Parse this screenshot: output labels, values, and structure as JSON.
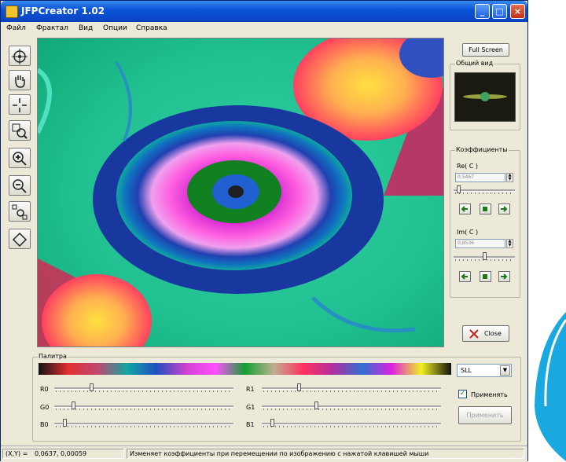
{
  "window": {
    "title": "JFPCreator 1.02"
  },
  "menu": {
    "items": [
      "Файл",
      "Фрактал",
      "Вид",
      "Опции",
      "Справка"
    ]
  },
  "toolbar": {
    "icons": [
      "target-icon",
      "hand-icon",
      "crosshair-icon",
      "zoom-window-icon",
      "zoom-in-icon",
      "zoom-out-icon",
      "fit-icon",
      "diamond-icon"
    ]
  },
  "right_panel": {
    "fullscreen_label": "Full Screen",
    "overview_label": "Общий вид",
    "coeff_label": "Коэффициенты",
    "re_label": "Re( C )",
    "re_value": "0,5467",
    "im_label": "Im( C )",
    "im_value": "0,8536",
    "close_label": "Close",
    "re_slider_value": 0.05,
    "im_slider_value": 0.5
  },
  "palette": {
    "label": "Палитра",
    "select_value": "SLL",
    "apply_checkbox_label": "Применять",
    "apply_checked": true,
    "apply_button_label": "Применить",
    "sliders": [
      {
        "label": "R0",
        "value": 0.2
      },
      {
        "label": "G0",
        "value": 0.1
      },
      {
        "label": "B0",
        "value": 0.05
      },
      {
        "label": "R1",
        "value": 0.2
      },
      {
        "label": "G1",
        "value": 0.3
      },
      {
        "label": "B1",
        "value": 0.05
      }
    ],
    "swatches": [
      "#111111",
      "#e23030",
      "#c04870",
      "#10a8a0",
      "#2050c0",
      "#d040d0",
      "#ff50ff",
      "#10a030",
      "#c0b090",
      "#ff3060",
      "#b030a0",
      "#3070d0",
      "#e020e0",
      "#f0f020"
    ]
  },
  "status": {
    "coord_label": "(X,Y) =",
    "x_value": "0,0637",
    "y_value": "0,00059",
    "message": "Изменяет коэффициенты при перемещении по изображению с нажатой клавишей мыши"
  }
}
